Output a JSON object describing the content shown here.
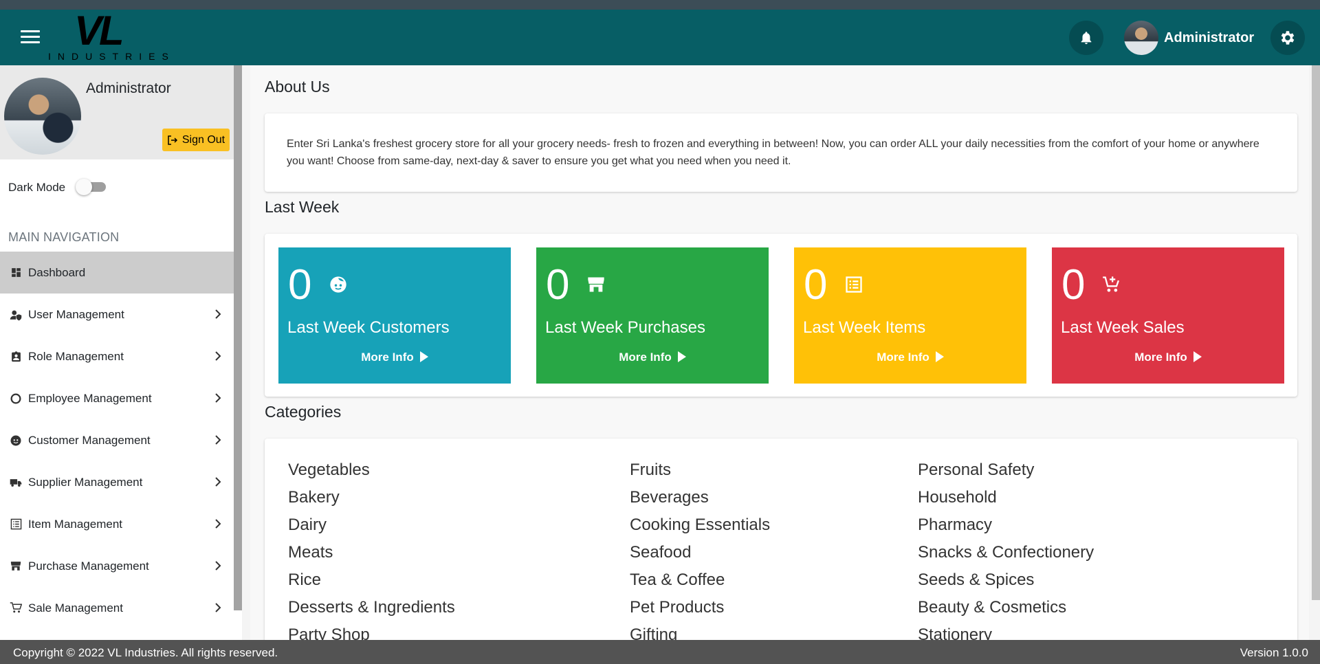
{
  "header": {
    "logo_main": "VL",
    "logo_sub": "INDUSTRIES",
    "user_name": "Administrator"
  },
  "sidebar": {
    "profile_name": "Administrator",
    "signout_label": "Sign Out",
    "dark_mode_label": "Dark Mode",
    "dark_mode_on": false,
    "nav_header": "MAIN NAVIGATION",
    "items": [
      {
        "label": "Dashboard",
        "icon": "dashboard-icon"
      },
      {
        "label": "User Management",
        "icon": "user-shield-icon"
      },
      {
        "label": "Role Management",
        "icon": "badge-icon"
      },
      {
        "label": "Employee Management",
        "icon": "circle-icon"
      },
      {
        "label": "Customer Management",
        "icon": "face-icon"
      },
      {
        "label": "Supplier Management",
        "icon": "truck-icon"
      },
      {
        "label": "Item Management",
        "icon": "list-icon"
      },
      {
        "label": "Purchase Management",
        "icon": "store-icon"
      },
      {
        "label": "Sale Management",
        "icon": "cart-icon"
      }
    ]
  },
  "main": {
    "about_title": "About Us",
    "about_text": "Enter Sri Lanka's freshest grocery store for all your grocery needs- fresh to frozen and everything in between! Now, you can order ALL your daily necessities from the comfort of your home or anywhere you want! Choose from same-day, next-day & saver to ensure you get what you need when you need it.",
    "last_week_title": "Last Week",
    "stats": [
      {
        "value": "0",
        "label": "Last Week Customers",
        "more": "More Info",
        "color": "#17a2b8",
        "icon": "face-icon"
      },
      {
        "value": "0",
        "label": "Last Week Purchases",
        "more": "More Info",
        "color": "#28a745",
        "icon": "store-icon"
      },
      {
        "value": "0",
        "label": "Last Week Items",
        "more": "More Info",
        "color": "#ffc107",
        "icon": "list-icon"
      },
      {
        "value": "0",
        "label": "Last Week Sales",
        "more": "More Info",
        "color": "#dc3545",
        "icon": "add-cart-icon"
      }
    ],
    "categories_title": "Categories",
    "categories": [
      [
        "Vegetables",
        "Bakery",
        "Dairy",
        "Meats",
        "Rice",
        "Desserts & Ingredients",
        "Party Shop"
      ],
      [
        "Fruits",
        "Beverages",
        "Cooking Essentials",
        "Seafood",
        "Tea & Coffee",
        "Pet Products",
        "Gifting"
      ],
      [
        "Personal Safety",
        "Household",
        "Pharmacy",
        "Snacks & Confectionery",
        "Seeds & Spices",
        "Beauty & Cosmetics",
        "Stationery"
      ]
    ]
  },
  "footer": {
    "copyright": "Copyright © 2022 VL Industries. All rights reserved.",
    "version": "Version 1.0.0"
  },
  "colors": {
    "header": "#075e65",
    "signout": "#f9c023",
    "footer": "#535353"
  }
}
